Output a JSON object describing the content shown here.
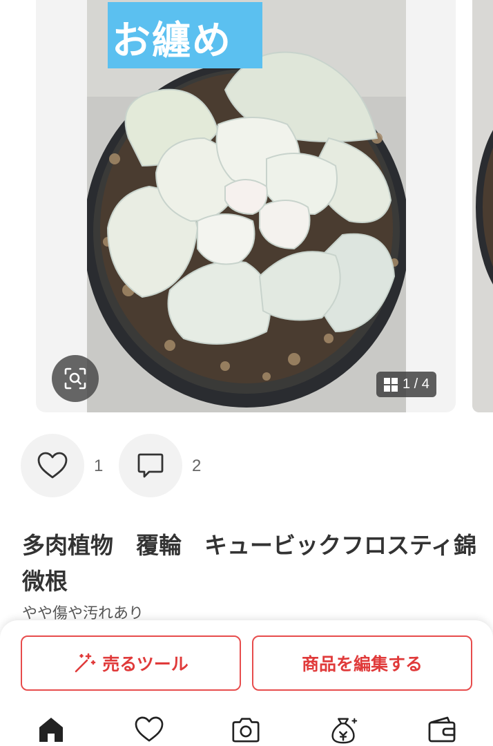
{
  "carousel": {
    "overlay_text": "お纏め",
    "counter": "1 / 4",
    "zoom_icon": "zoom-scan-icon",
    "counter_icon": "grid-icon"
  },
  "reactions": {
    "likes": "1",
    "comments": "2"
  },
  "item": {
    "title": "多肉植物　覆輪　キュービックフロスティ錦　微根",
    "condition": "やや傷や汚れあり"
  },
  "actions": {
    "sell_tool": "売るツール",
    "edit_item": "商品を編集する"
  },
  "tabbar": {
    "icons": [
      "home-icon",
      "heart-icon",
      "camera-icon",
      "money-bag-icon",
      "wallet-icon"
    ]
  },
  "colors": {
    "accent": "#e03a3a",
    "overlay_bg": "#5bc0f0"
  }
}
